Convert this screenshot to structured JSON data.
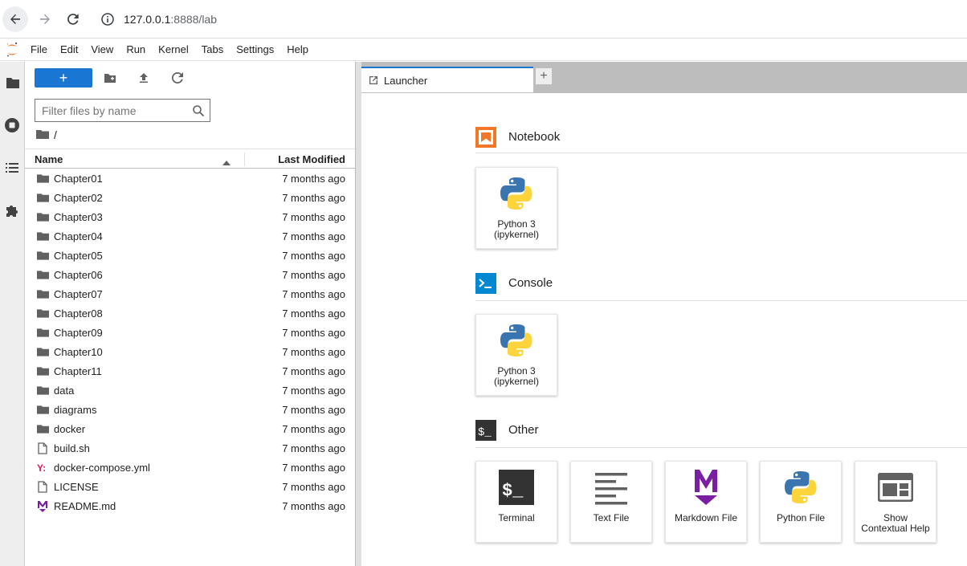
{
  "browser": {
    "url_host": "127.0.0.1",
    "url_path": ":8888/lab"
  },
  "menubar": {
    "items": [
      "File",
      "Edit",
      "View",
      "Run",
      "Kernel",
      "Tabs",
      "Settings",
      "Help"
    ]
  },
  "filebrowser": {
    "new_label": "+",
    "search_placeholder": "Filter files by name",
    "breadcrumb": "/",
    "columns": {
      "name": "Name",
      "modified": "Last Modified"
    },
    "items": [
      {
        "name": "Chapter01",
        "type": "folder",
        "modified": "7 months ago"
      },
      {
        "name": "Chapter02",
        "type": "folder",
        "modified": "7 months ago"
      },
      {
        "name": "Chapter03",
        "type": "folder",
        "modified": "7 months ago"
      },
      {
        "name": "Chapter04",
        "type": "folder",
        "modified": "7 months ago"
      },
      {
        "name": "Chapter05",
        "type": "folder",
        "modified": "7 months ago"
      },
      {
        "name": "Chapter06",
        "type": "folder",
        "modified": "7 months ago"
      },
      {
        "name": "Chapter07",
        "type": "folder",
        "modified": "7 months ago"
      },
      {
        "name": "Chapter08",
        "type": "folder",
        "modified": "7 months ago"
      },
      {
        "name": "Chapter09",
        "type": "folder",
        "modified": "7 months ago"
      },
      {
        "name": "Chapter10",
        "type": "folder",
        "modified": "7 months ago"
      },
      {
        "name": "Chapter11",
        "type": "folder",
        "modified": "7 months ago"
      },
      {
        "name": "data",
        "type": "folder",
        "modified": "7 months ago"
      },
      {
        "name": "diagrams",
        "type": "folder",
        "modified": "7 months ago"
      },
      {
        "name": "docker",
        "type": "folder",
        "modified": "7 months ago"
      },
      {
        "name": "build.sh",
        "type": "file",
        "modified": "7 months ago"
      },
      {
        "name": "docker-compose.yml",
        "type": "yaml",
        "modified": "7 months ago"
      },
      {
        "name": "LICENSE",
        "type": "file",
        "modified": "7 months ago"
      },
      {
        "name": "README.md",
        "type": "markdown",
        "modified": "7 months ago"
      }
    ]
  },
  "tabs": {
    "launcher_label": "Launcher",
    "add_label": "+"
  },
  "launcher": {
    "notebook": {
      "title": "Notebook",
      "cards": [
        {
          "line1": "Python 3",
          "line2": "(ipykernel)"
        }
      ]
    },
    "console": {
      "title": "Console",
      "cards": [
        {
          "line1": "Python 3",
          "line2": "(ipykernel)"
        }
      ]
    },
    "other": {
      "title": "Other",
      "cards": [
        {
          "line1": "Terminal",
          "line2": ""
        },
        {
          "line1": "Text File",
          "line2": ""
        },
        {
          "line1": "Markdown File",
          "line2": ""
        },
        {
          "line1": "Python File",
          "line2": ""
        },
        {
          "line1": "Show",
          "line2": "Contextual Help"
        }
      ]
    }
  },
  "colors": {
    "accent": "#1976d2",
    "notebook_icon": "#f37726",
    "console_icon": "#0288d1",
    "markdown_icon": "#7b1fa2",
    "yaml_icon": "#d81b60"
  }
}
